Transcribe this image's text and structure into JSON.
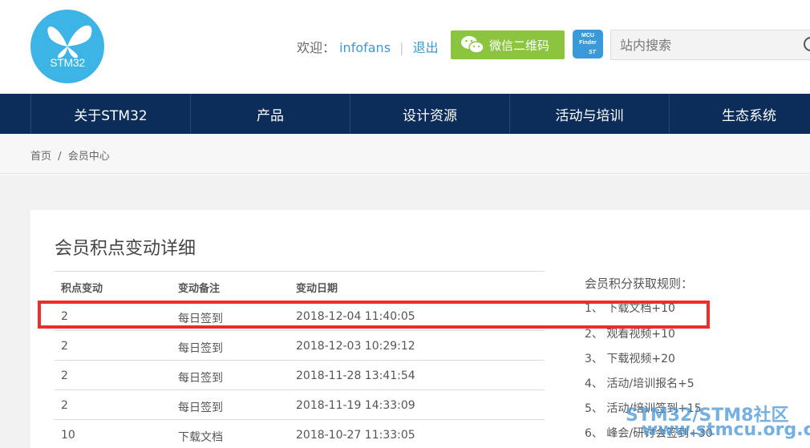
{
  "header": {
    "logo_text": "STM32",
    "welcome_label": "欢迎：",
    "username": "infofans",
    "separator": "|",
    "logout_label": "退出",
    "wechat_label": "微信二维码",
    "mcu_badge_line1": "MCU",
    "mcu_badge_line2": "Finder",
    "mcu_badge_brand": "ST",
    "search_placeholder": "站内搜索",
    "search_icon": "search-icon"
  },
  "nav": {
    "items": [
      "关于STM32",
      "产品",
      "设计资源",
      "活动与培训",
      "生态系统"
    ]
  },
  "breadcrumb": {
    "home": "首页",
    "separator": "/",
    "current": "会员中心"
  },
  "main": {
    "title": "会员积点变动详细",
    "table": {
      "headers": [
        "积点变动",
        "变动备注",
        "变动日期"
      ],
      "rows": [
        [
          "2",
          "每日签到",
          "2018-12-04 11:40:05"
        ],
        [
          "2",
          "每日签到",
          "2018-12-03 10:29:12"
        ],
        [
          "2",
          "每日签到",
          "2018-11-28 13:41:54"
        ],
        [
          "2",
          "每日签到",
          "2018-11-19 14:33:09"
        ],
        [
          "10",
          "下载文档",
          "2018-10-27 11:33:05"
        ]
      ]
    },
    "rules": {
      "title": "会员积分获取规则：",
      "items": [
        "1、 下载文档+10",
        "2、 观看视频+10",
        "3、 下载视频+20",
        "4、 活动/培训报名+5",
        "5、 活动/培训签到+15",
        "6、 峰会/研讨会签到+30"
      ]
    }
  },
  "watermark": {
    "line1": "STM32/STM8社区",
    "line2": "www.stmcu.org.cn"
  },
  "colors": {
    "nav_bg": "#0c2d5a",
    "accent_blue": "#3a99d8",
    "wechat_green": "#8bc53f",
    "highlight_red": "#ee2c2c"
  }
}
